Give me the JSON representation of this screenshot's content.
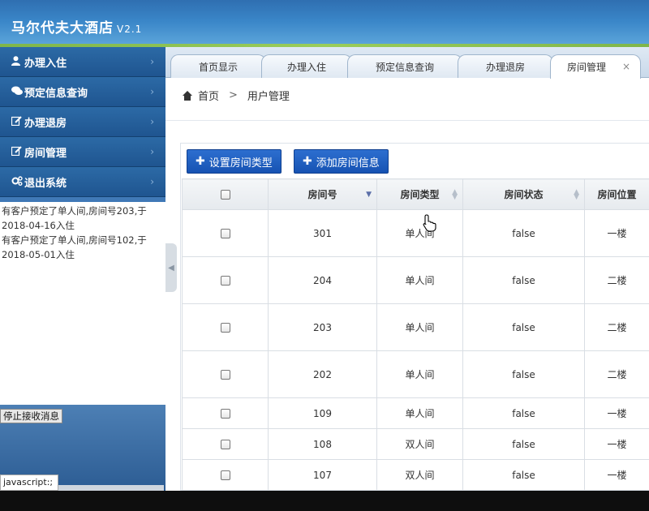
{
  "header": {
    "title": "马尔代夫大酒店",
    "version": "V2.1"
  },
  "sidebar": {
    "items": [
      {
        "label": "办理入住",
        "icon": "user-icon"
      },
      {
        "label": "预定信息查询",
        "icon": "comments-icon"
      },
      {
        "label": "办理退房",
        "icon": "edit-icon"
      },
      {
        "label": "房间管理",
        "icon": "edit-icon"
      },
      {
        "label": "退出系统",
        "icon": "gears-icon"
      }
    ],
    "messages": [
      "有客户预定了单人间,房间号203,于2018-04-16入住",
      "有客户预定了单人间,房间号102,于2018-05-01入住"
    ],
    "stop_button": "停止接收消息",
    "status_text": "javascript:;"
  },
  "tabs": [
    {
      "label": "首页显示"
    },
    {
      "label": "办理入住"
    },
    {
      "label": "预定信息查询"
    },
    {
      "label": "办理退房"
    },
    {
      "label": "房间管理",
      "active": true,
      "close": "×"
    }
  ],
  "breadcrumb": {
    "home": "首页",
    "sep": ">",
    "current": "用户管理"
  },
  "toolbar": {
    "set_type": "设置房间类型",
    "add_room": "添加房间信息",
    "plus": "✚"
  },
  "table": {
    "columns": [
      "房间号",
      "房间类型",
      "房间状态",
      "房间位置"
    ],
    "rows": [
      {
        "no": "301",
        "type": "单人间",
        "status": "false",
        "loc": "一楼"
      },
      {
        "no": "204",
        "type": "单人间",
        "status": "false",
        "loc": "二楼"
      },
      {
        "no": "203",
        "type": "单人间",
        "status": "false",
        "loc": "二楼"
      },
      {
        "no": "202",
        "type": "单人间",
        "status": "false",
        "loc": "二楼"
      },
      {
        "no": "109",
        "type": "单人间",
        "status": "false",
        "loc": "一楼"
      },
      {
        "no": "108",
        "type": "双人间",
        "status": "false",
        "loc": "一楼"
      },
      {
        "no": "107",
        "type": "双人间",
        "status": "false",
        "loc": "一楼"
      }
    ]
  },
  "colors": {
    "primary_button": "#1a5bbf",
    "header": "#3a86c8",
    "accent_strip": "#8cc152"
  }
}
